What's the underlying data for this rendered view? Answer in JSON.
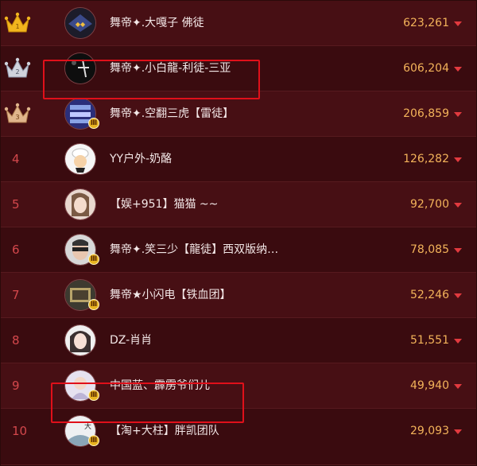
{
  "leaderboard": {
    "rows": [
      {
        "rank": "1",
        "name": "舞帝✦.大嘎子 佛徒",
        "score": "623,261",
        "crown": "gold-crown-icon",
        "avatar": "a1"
      },
      {
        "rank": "2",
        "name": "舞帝✦.小白龍-利徒-三亚",
        "score": "606,204",
        "crown": "silver-crown-icon",
        "avatar": "a2"
      },
      {
        "rank": "3",
        "name": "舞帝✦.空翻三虎【雷徒】",
        "score": "206,859",
        "crown": "bronze-crown-icon",
        "avatar": "a3"
      },
      {
        "rank": "4",
        "name": "YY户外-奶酪",
        "score": "126,282",
        "avatar": "a4"
      },
      {
        "rank": "5",
        "name": "【娱+951】猫猫 ~~",
        "score": "92,700",
        "avatar": "a5"
      },
      {
        "rank": "6",
        "name": "舞帝✦.笑三少【龍徒】西双版纳…",
        "score": "78,085",
        "avatar": "a6"
      },
      {
        "rank": "7",
        "name": "舞帝★小闪电【铁血团】",
        "score": "52,246",
        "avatar": "a7"
      },
      {
        "rank": "8",
        "name": "DZ-肖肖",
        "score": "51,551",
        "avatar": "a8"
      },
      {
        "rank": "9",
        "name": "中国蓝、霹雳爷们儿",
        "score": "49,940",
        "avatar": "a9"
      },
      {
        "rank": "10",
        "name": "【淘+大柱】胖凯团队",
        "score": "29,093",
        "avatar": "a10"
      }
    ]
  },
  "colors": {
    "background": "#3c0c10",
    "rank_number": "#d4484c",
    "score": "#f3b35a",
    "trend_arrow": "#e23a3f",
    "highlight_box": "#e0101a"
  }
}
